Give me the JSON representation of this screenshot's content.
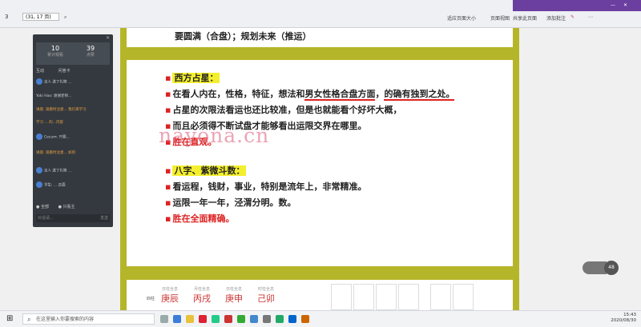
{
  "toolbar": {
    "page_number": "3",
    "page_box": "(31, 17 页)",
    "fit_width": "适应页面大小",
    "page_view": "页面视图",
    "share": "共享此页面",
    "notes": "添加批注"
  },
  "chat_panel": {
    "stat1_value": "10",
    "stat1_label": "累计观看",
    "stat2_value": "39",
    "stat2_label": "点赞",
    "tab1": "互动",
    "tab2": "问答卡",
    "messages": [
      "吉人 送了礼物 ...",
      "Yoki Hao: 谢谢老师...",
      "讲座: 观看时注意... 我们来学习",
      "学习 ... 的...内容",
      "Cecum: 只要...",
      "讲座: 观看时注意... 如何",
      "吉人 送了礼物 ...",
      "学生: ... 正面"
    ],
    "opt1": "全部",
    "opt2": "只看主",
    "input_placeholder": "对话请...",
    "send": "发送"
  },
  "slide": {
    "top_line": "要圆满（合盘）；规划未来（推运）",
    "section1_title": "西方占星：",
    "s1_line1a": "在看人内在，性格，特征，想法和",
    "s1_line1b": "男女性格合盘方面",
    "s1_line1c": "，",
    "s1_line1d": "的确有独到之处。",
    "s1_line2": "占星的次限法看运也还比较准，但是也就能看个好坏大概，",
    "s1_line3": "而且必须得不断试盘才能够看出运限交界在哪里。",
    "s1_line4": "胜在直观。",
    "section2_title": "八字、紫微斗数：",
    "s2_line1": "看运程，钱财，事业，特别是流年上，非常精准。",
    "s2_line2": "运限一年一年，泾渭分明。数。",
    "s2_line3": "胜在全面精确。",
    "watermark": "nayona.cn",
    "table": {
      "row_label": "四柱",
      "cols": [
        {
          "top": "日柱全息",
          "big": "庚辰"
        },
        {
          "top": "月柱全息",
          "big": "丙戌"
        },
        {
          "top": "日柱全息",
          "big": "庚申"
        },
        {
          "top": "时柱全息",
          "big": "己卯"
        }
      ]
    }
  },
  "recorder": {
    "badge": "48"
  },
  "taskbar": {
    "search_placeholder": "在这里输入你要搜索的内容",
    "time": "15:43",
    "date": "2020/08/30"
  },
  "colors": {
    "slide_frame": "#b5b52a",
    "highlight": "#f4ef2e",
    "accent_red": "#d22222",
    "chat_bg": "#34393f"
  }
}
